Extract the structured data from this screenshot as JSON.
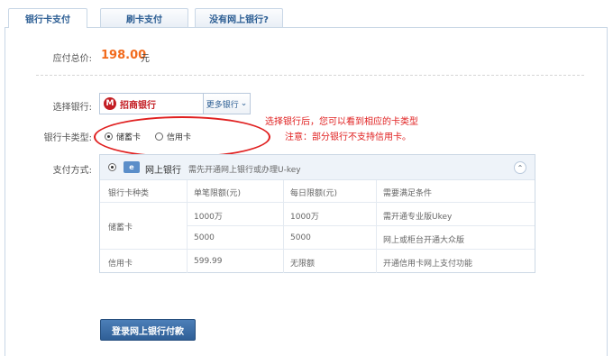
{
  "tabs": [
    {
      "label": "银行卡支付"
    },
    {
      "label": "刷卡支付"
    },
    {
      "label": "没有网上银行?"
    }
  ],
  "order": {
    "total_label": "应付总价:",
    "amount": "198.00",
    "currency": "元"
  },
  "bank": {
    "label": "选择银行:",
    "selected_name": "招商银行",
    "more_label": "更多银行"
  },
  "card_type": {
    "label": "银行卡类型:",
    "options": [
      "储蓄卡",
      "信用卡"
    ],
    "selected": "储蓄卡"
  },
  "annotation": {
    "line1": "选择银行后，您可以看到相应的卡类型",
    "line2": "注意：部分银行不支持信用卡。"
  },
  "payment": {
    "label": "支付方式:",
    "method_name": "网上银行",
    "method_hint": "需先开通网上银行或办理U-key",
    "icon": "e-pay-icon",
    "table": {
      "headers": [
        "银行卡种类",
        "单笔限额(元)",
        "每日限额(元)",
        "需要满足条件"
      ],
      "rows": [
        [
          "储蓄卡",
          "1000万",
          "1000万",
          "需开通专业版Ukey"
        ],
        [
          "",
          "5000",
          "5000",
          "网上或柜台开通大众版"
        ],
        [
          "信用卡",
          "599.99",
          "无限额",
          "开通信用卡网上支付功能"
        ]
      ]
    }
  },
  "submit": {
    "label": "登录网上银行付款"
  },
  "colors": {
    "accent": "#2b5d93",
    "price": "#f26b1d",
    "annotation": "#e02020",
    "bank": "#c31d23"
  }
}
